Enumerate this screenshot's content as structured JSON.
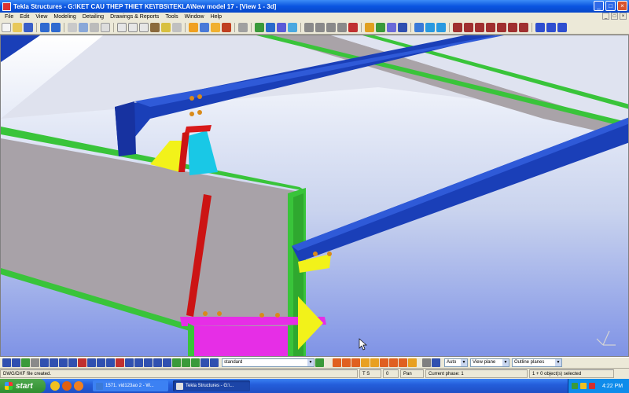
{
  "window": {
    "title": "Tekla Structures - G:\\KET CAU THEP THIET KE\\TBS\\TEKLA\\New model 17 - [View 1 - 3d]",
    "minimize": "_",
    "maximize": "□",
    "close": "×"
  },
  "menu": {
    "items": [
      "File",
      "Edit",
      "View",
      "Modeling",
      "Detailing",
      "Drawings & Reports",
      "Tools",
      "Window",
      "Help"
    ]
  },
  "mdi": {
    "minimize": "_",
    "restore": "□",
    "close": "×"
  },
  "colors": {
    "beam_blue": "#1a3fb8",
    "column_green": "#3ac83a",
    "plate_magenta": "#e62ee6",
    "stiffener_yellow": "#f2f21a",
    "stiffener_cyan": "#19c8e6",
    "brace_red": "#cc1414",
    "bolt_orange": "#d98a1a",
    "slab_gray": "#a9a3a8"
  },
  "bottom_toolbar": {
    "filter_combo": "standard",
    "snap_combo": "Auto",
    "plane_combo": "View plane",
    "outline_combo": "Outline planes"
  },
  "status": {
    "message": "DWG/DXF file created.",
    "ts": "T S",
    "zero": "0",
    "mode": "Pan",
    "phase": "Current phase: 1",
    "selection": "1 + 0 object(s) selected"
  },
  "taskbar": {
    "start": "start",
    "task1": "1571. vid123ao 2 - W...",
    "task2": "Tekla Structures - G:\\...",
    "clock": "4:22 PM"
  }
}
